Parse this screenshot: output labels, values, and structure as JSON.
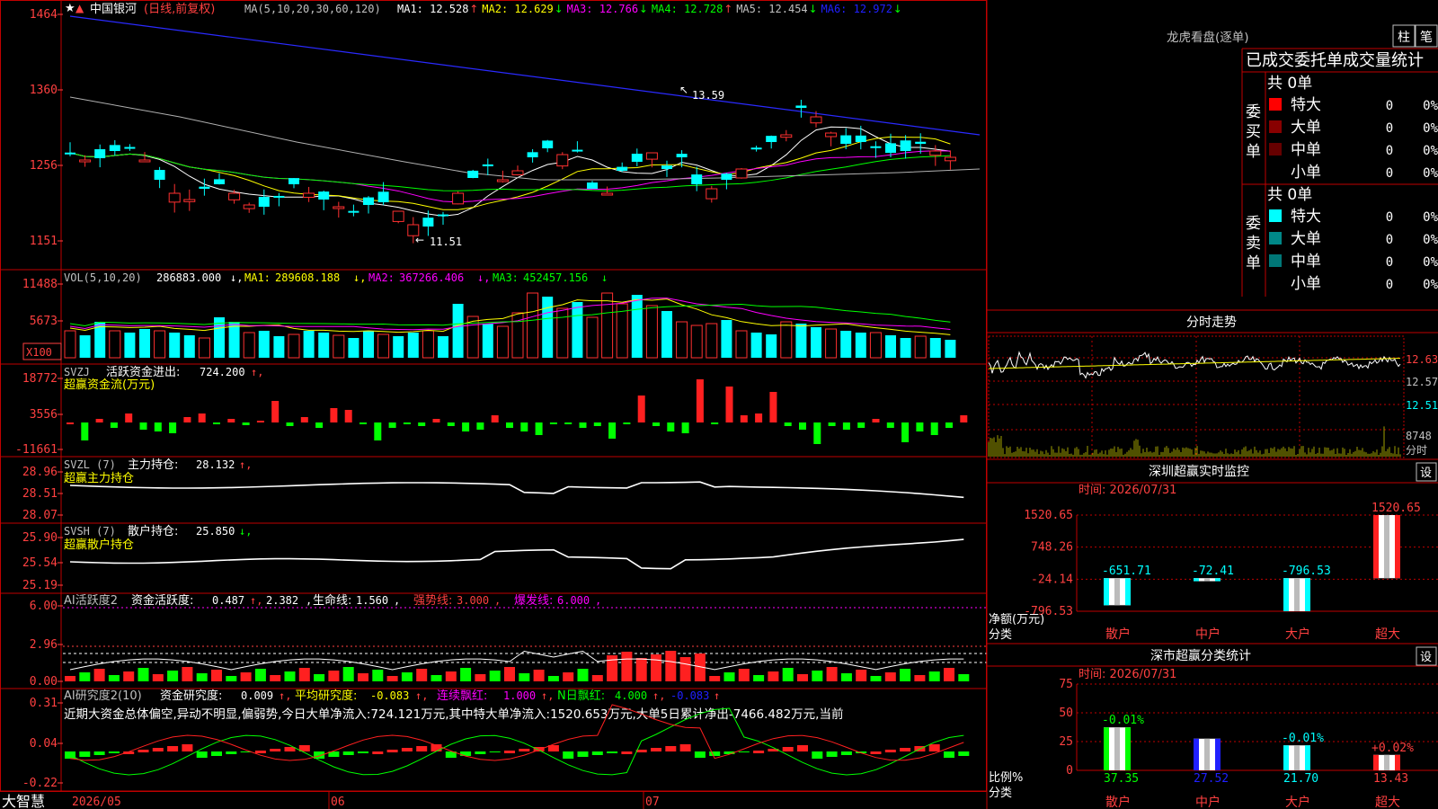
{
  "stock": {
    "name": "中国银河",
    "period": "(日线,前复权)"
  },
  "ma_legend": {
    "label": "MA(5,10,20,30,60,120)",
    "items": [
      {
        "name": "MA1",
        "value": "12.528",
        "arrow": "↑",
        "color": "#ffffff"
      },
      {
        "name": "MA2",
        "value": "12.629",
        "arrow": "↓",
        "color": "#ffff00"
      },
      {
        "name": "MA3",
        "value": "12.766",
        "arrow": "↓",
        "color": "#ff00ff"
      },
      {
        "name": "MA4",
        "value": "12.728",
        "arrow": "↑",
        "color": "#00ff00"
      },
      {
        "name": "MA5",
        "value": "12.454",
        "arrow": "↓",
        "color": "#c0c0c0"
      },
      {
        "name": "MA6",
        "value": "12.972",
        "arrow": "↓",
        "color": "#2020ff"
      }
    ]
  },
  "price_axis": [
    "1464",
    "1360",
    "1256",
    "1151"
  ],
  "price_annotations": {
    "high": "13.59",
    "low": "11.51"
  },
  "vol_legend": {
    "label": "VOL(5,10,20)",
    "value": "286883.000",
    "ma1": "289608.188",
    "ma2": "367266.406",
    "ma3": "452457.156"
  },
  "vol_axis": [
    "11488",
    "5673"
  ],
  "vol_unit": "X100",
  "svzj": {
    "label": "SVZJ",
    "sub": "活跃资金进出:",
    "value": "724.200",
    "caption": "超赢资金流(万元)",
    "axis": [
      "18772",
      "3556",
      "-11661"
    ]
  },
  "svzl": {
    "label": "SVZL (7)",
    "sub": "主力持仓:",
    "value": "28.132",
    "caption": "超赢主力持仓",
    "axis": [
      "28.96",
      "28.51",
      "28.07"
    ]
  },
  "svsh": {
    "label": "SVSH (7)",
    "sub": "散户持仓:",
    "value": "25.850",
    "caption": "超赢散户持仓",
    "axis": [
      "25.90",
      "25.54",
      "25.19"
    ]
  },
  "ai_active": {
    "label": "AI活跃度2",
    "sub": "资金活跃度:",
    "v1": "0.487",
    "v2": "2.382",
    "life_label": "生命线:",
    "life": "1.560",
    "strong_label": "强势线:",
    "strong": "3.000",
    "burst_label": "爆发线:",
    "burst": "6.000",
    "axis": [
      "6.00",
      "2.96",
      "0.00"
    ]
  },
  "ai_research": {
    "label": "AI研究度2(10)",
    "sub": "资金研究度:",
    "v1": "0.009",
    "avg_label": "平均研究度:",
    "avg": "-0.083",
    "cont_label": "连续飘红:",
    "cont": "1.000",
    "n_label": "N日飘红:",
    "n": "4.000",
    "v5": "-0.083",
    "axis": [
      "0.31",
      "0.04",
      "-0.22"
    ],
    "summary": "近期大资金总体偏空,异动不明显,偏弱势,今日大单净流入:724.121万元,其中特大单净流入:1520.653万元,大单5日累计净出-7466.482万元,当前"
  },
  "date_axis": [
    "2026/05",
    "06",
    "07"
  ],
  "brand": "大智慧",
  "right": {
    "dragon_title": "龙虎看盘(逐单)",
    "tab_bar": "柱",
    "tab_pen": "笔",
    "stats_title": "已成交委托单成交量统计",
    "buy_side": "委买单",
    "sell_side": "委卖单",
    "buy_total": "共 0单",
    "sell_total": "共 0单",
    "buy_rows": [
      {
        "label": "特大",
        "count": "0",
        "pct": "0%",
        "color": "#ff0000"
      },
      {
        "label": "大单",
        "count": "0",
        "pct": "0%",
        "color": "#880000"
      },
      {
        "label": "中单",
        "count": "0",
        "pct": "0%",
        "color": "#660000"
      },
      {
        "label": "小单",
        "count": "0",
        "pct": "0%",
        "color": ""
      }
    ],
    "sell_rows": [
      {
        "label": "特大",
        "count": "0",
        "pct": "0%",
        "color": "#00ffff"
      },
      {
        "label": "大单",
        "count": "0",
        "pct": "0%",
        "color": "#008888"
      },
      {
        "label": "中单",
        "count": "0",
        "pct": "0%",
        "color": "#007777"
      },
      {
        "label": "小单",
        "count": "0",
        "pct": "0%",
        "color": ""
      }
    ],
    "intraday_title": "分时走势",
    "intraday_axis": [
      "12.63",
      "12.57",
      "12.51"
    ],
    "intraday_vol": "8748",
    "intraday_vol_unit": "分时",
    "monitor_title": "深圳超赢实时监控",
    "monitor_time": "时间: 2026/07/31",
    "monitor_set": "设",
    "monitor_axis": [
      "1520.65",
      "748.26",
      "-24.14",
      "-796.53"
    ],
    "monitor_ylabel": "净额(万元)",
    "monitor_xlabel": "分类",
    "classify_title": "深市超赢分类统计",
    "classify_time": "时间: 2026/07/31",
    "classify_set": "设",
    "classify_axis": [
      "75",
      "50",
      "25",
      "0"
    ],
    "classify_ylabel": "比例%",
    "classify_xlabel": "分类"
  },
  "chart_data": [
    {
      "type": "bar",
      "title": "深圳超赢实时监控",
      "categories": [
        "散户",
        "中户",
        "大户",
        "超大"
      ],
      "values": [
        -651.71,
        -72.41,
        -796.53,
        1520.65
      ],
      "ylim": [
        -796.53,
        1520.65
      ],
      "ylabel": "净额(万元)",
      "xlabel": "分类"
    },
    {
      "type": "bar",
      "title": "深市超赢分类统计",
      "categories": [
        "散户",
        "中户",
        "大户",
        "超大"
      ],
      "values": [
        37.35,
        27.52,
        21.7,
        13.43
      ],
      "changes": [
        "-0.01%",
        "",
        "-0.01%",
        "+0.02%"
      ],
      "ylim": [
        0,
        75
      ],
      "ylabel": "比例%",
      "xlabel": "分类"
    }
  ]
}
